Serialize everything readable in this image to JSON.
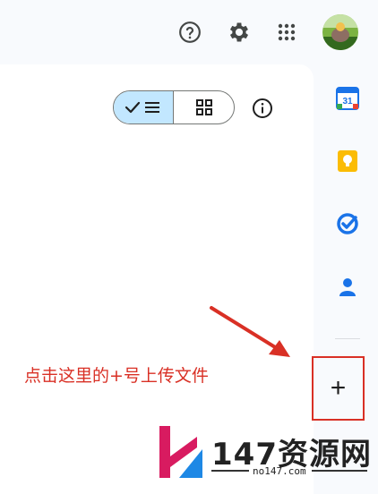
{
  "header": {
    "icons": [
      "help-icon",
      "settings-icon",
      "apps-grid-icon",
      "account-avatar"
    ]
  },
  "toolbar": {
    "view_toggle": {
      "selected": "list",
      "options": [
        "list",
        "grid"
      ]
    },
    "info_icon": "info-icon"
  },
  "side_panel": {
    "apps": [
      {
        "name": "Google Calendar",
        "icon": "calendar-icon",
        "badge": "31",
        "color": "#1a73e8"
      },
      {
        "name": "Google Keep",
        "icon": "keep-icon",
        "color": "#fbbc04"
      },
      {
        "name": "Google Tasks",
        "icon": "tasks-icon",
        "color": "#1a73e8"
      },
      {
        "name": "Contacts",
        "icon": "contacts-icon",
        "color": "#1a73e8"
      }
    ],
    "add_button_label": "+"
  },
  "annotation": {
    "text": "点击这里的+号上传文件",
    "color": "#d93025"
  },
  "watermark": {
    "title": "147资源网",
    "url": "no147.com"
  }
}
